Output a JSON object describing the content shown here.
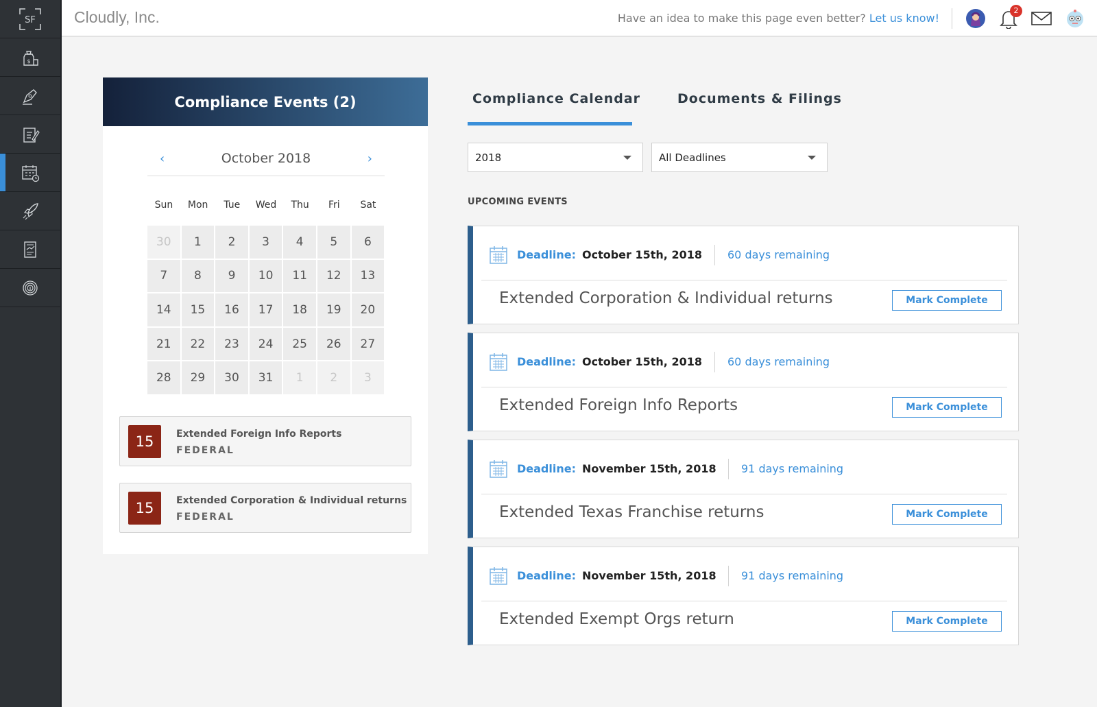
{
  "header": {
    "company": "Cloudly, Inc.",
    "feedback_text": "Have an idea to make this page even better?",
    "feedback_link": "Let us know!",
    "notification_count": "2"
  },
  "sidebar": {
    "logo": "SF",
    "items": [
      {
        "icon": "finance-icon",
        "active": false
      },
      {
        "icon": "pen-icon",
        "active": false
      },
      {
        "icon": "edit-document-icon",
        "active": false
      },
      {
        "icon": "calendar-clock-icon",
        "active": true
      },
      {
        "icon": "rocket-icon",
        "active": false
      },
      {
        "icon": "report-icon",
        "active": false
      },
      {
        "icon": "fingerprint-icon",
        "active": false
      }
    ]
  },
  "left_panel": {
    "title": "Compliance Events (2)",
    "month_label": "October 2018",
    "prev": "‹",
    "next": "›",
    "weekdays": [
      "Sun",
      "Mon",
      "Tue",
      "Wed",
      "Thu",
      "Fri",
      "Sat"
    ],
    "days": [
      {
        "n": "30",
        "muted": true
      },
      {
        "n": "1"
      },
      {
        "n": "2"
      },
      {
        "n": "3"
      },
      {
        "n": "4"
      },
      {
        "n": "5"
      },
      {
        "n": "6"
      },
      {
        "n": "7"
      },
      {
        "n": "8"
      },
      {
        "n": "9"
      },
      {
        "n": "10"
      },
      {
        "n": "11"
      },
      {
        "n": "12"
      },
      {
        "n": "13"
      },
      {
        "n": "14"
      },
      {
        "n": "15"
      },
      {
        "n": "16"
      },
      {
        "n": "17"
      },
      {
        "n": "18"
      },
      {
        "n": "19"
      },
      {
        "n": "20"
      },
      {
        "n": "21"
      },
      {
        "n": "22"
      },
      {
        "n": "23"
      },
      {
        "n": "24"
      },
      {
        "n": "25"
      },
      {
        "n": "26"
      },
      {
        "n": "27"
      },
      {
        "n": "28"
      },
      {
        "n": "29"
      },
      {
        "n": "30"
      },
      {
        "n": "31"
      },
      {
        "n": "1",
        "muted": true
      },
      {
        "n": "2",
        "muted": true
      },
      {
        "n": "3",
        "muted": true
      }
    ],
    "events": [
      {
        "day": "15",
        "title": "Extended Foreign Info Reports",
        "category": "FEDERAL"
      },
      {
        "day": "15",
        "title": "Extended Corporation & Individual returns",
        "category": "FEDERAL"
      }
    ]
  },
  "tabs": [
    {
      "label": "Compliance Calendar",
      "active": true
    },
    {
      "label": "Documents & Filings",
      "active": false
    }
  ],
  "filters": {
    "year": "2018",
    "deadline_type": "All Deadlines"
  },
  "upcoming": {
    "label": "UPCOMING EVENTS",
    "deadline_label": "Deadline:",
    "button_label": "Mark Complete",
    "items": [
      {
        "date": "October 15th, 2018",
        "remaining": "60 days remaining",
        "title": "Extended Corporation & Individual returns"
      },
      {
        "date": "October 15th, 2018",
        "remaining": "60 days remaining",
        "title": "Extended Foreign Info Reports"
      },
      {
        "date": "November 15th, 2018",
        "remaining": "91 days remaining",
        "title": "Extended Texas Franchise returns"
      },
      {
        "date": "November 15th, 2018",
        "remaining": "91 days remaining",
        "title": "Extended Exempt Orgs return"
      }
    ]
  },
  "colors": {
    "accent": "#3a8fd9",
    "sidebar": "#2e3236",
    "event_badge": "#8b2516",
    "card_border": "#2d5e8c"
  }
}
